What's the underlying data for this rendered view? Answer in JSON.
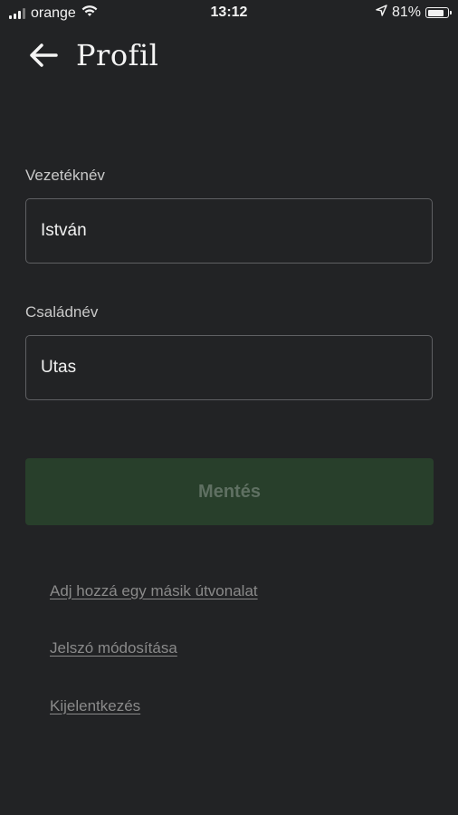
{
  "status_bar": {
    "carrier": "orange",
    "time": "13:12",
    "battery_percent": "81%",
    "battery_level": 0.81,
    "icons": [
      "signal-icon",
      "wifi-icon",
      "location-arrow-icon",
      "battery-icon"
    ]
  },
  "header": {
    "title": "Profil",
    "back_icon": "arrow-left-icon"
  },
  "form": {
    "last_name_label": "Vezetéknév",
    "last_name_value": "István",
    "first_name_label": "Családnév",
    "first_name_value": "Utas",
    "save_label": "Mentés"
  },
  "links": {
    "add_route": "Adj hozzá egy másik útvonalat",
    "change_password": "Jelszó módosítása",
    "logout": "Kijelentkezés"
  },
  "colors": {
    "background": "#222325",
    "input_border": "#5f6063",
    "save_button_bg": "#283f2b",
    "save_button_text": "#5f7062",
    "link_text": "#8a8a8a"
  }
}
